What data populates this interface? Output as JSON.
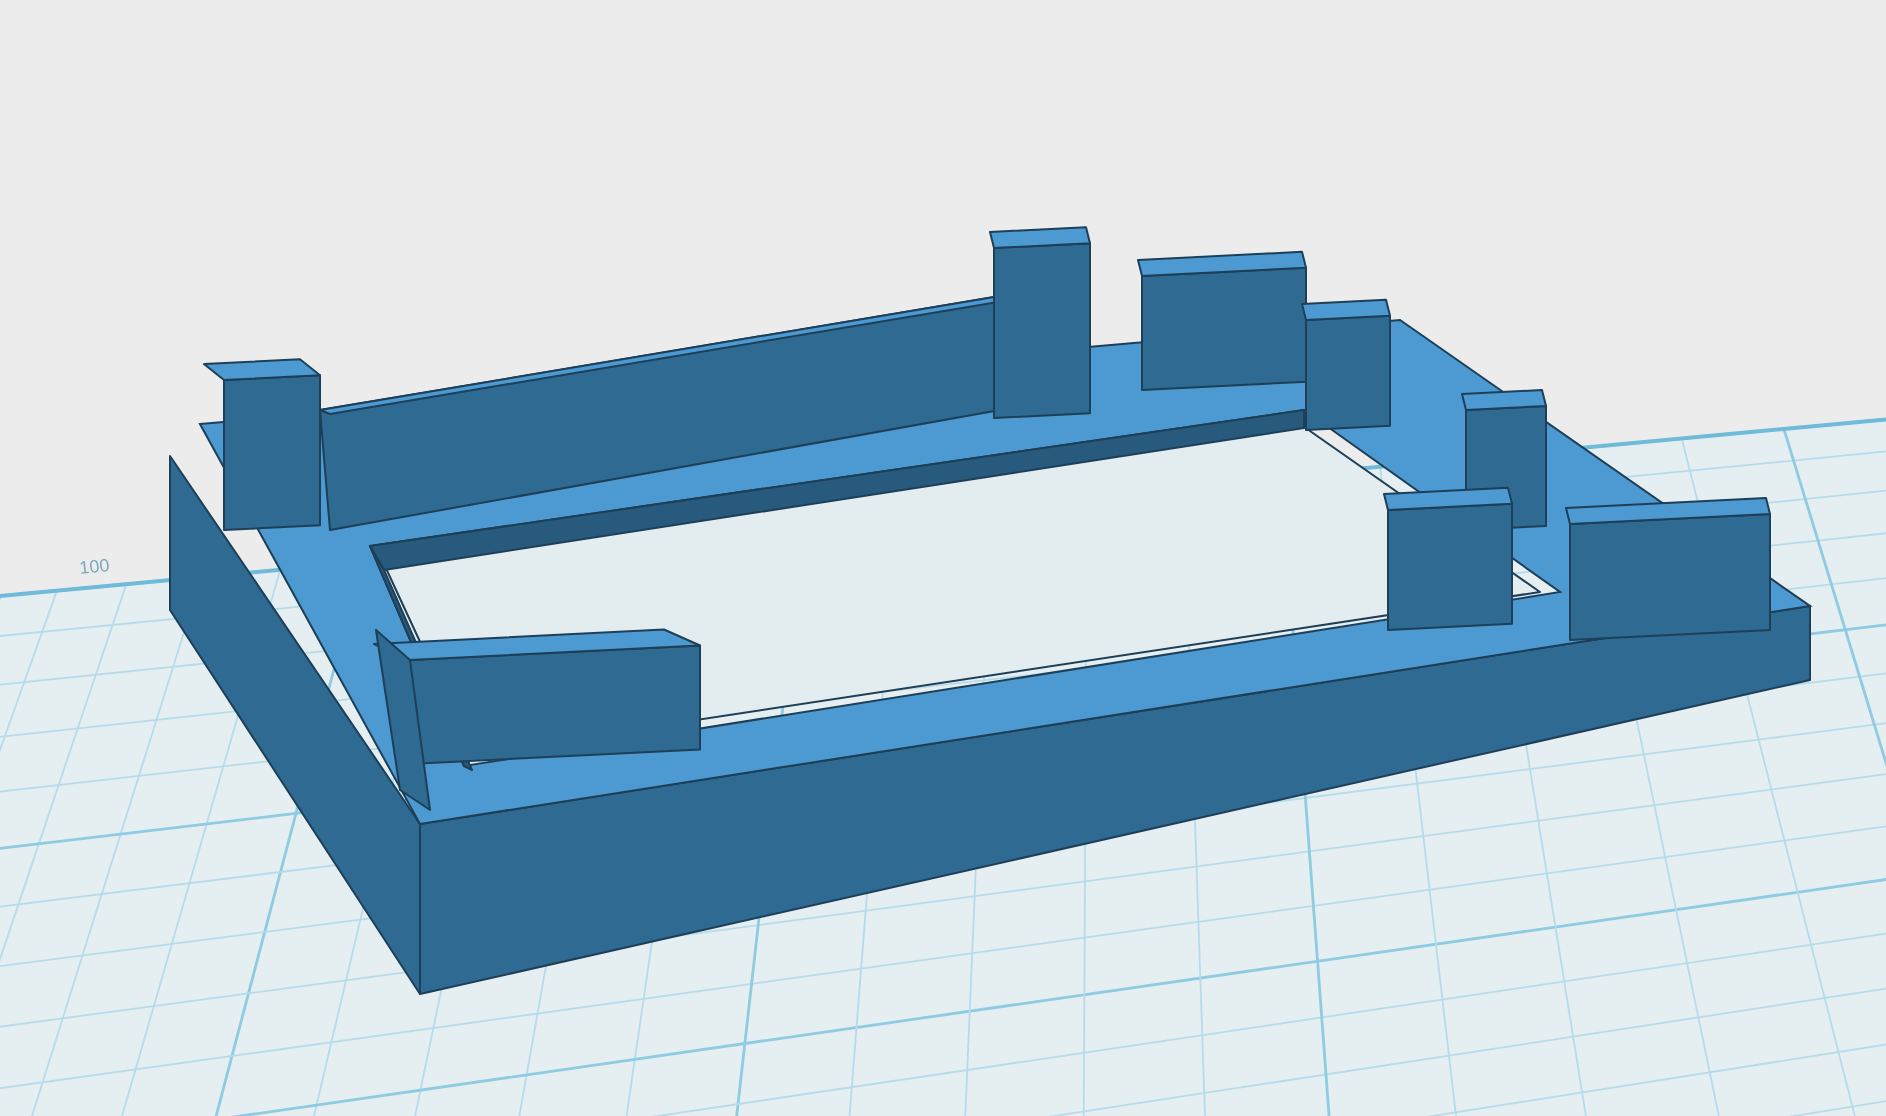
{
  "viewport": {
    "grid_label": "100"
  }
}
